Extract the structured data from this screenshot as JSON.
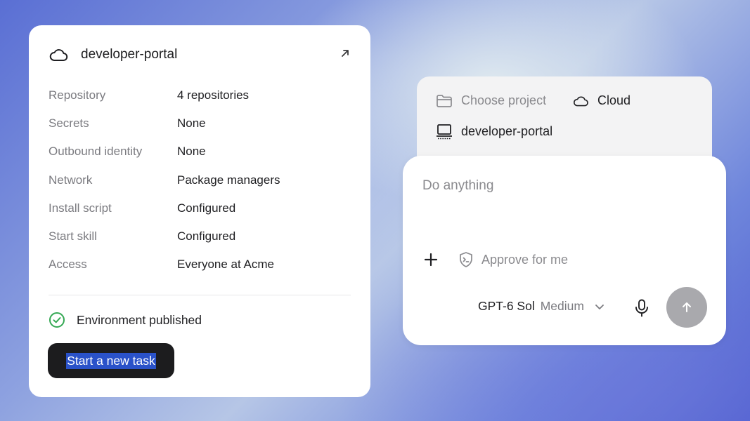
{
  "environment": {
    "title": "developer-portal",
    "properties": [
      {
        "key": "Repository",
        "value": "4 repositories"
      },
      {
        "key": "Secrets",
        "value": "None"
      },
      {
        "key": "Outbound identity",
        "value": "None"
      },
      {
        "key": "Network",
        "value": "Package managers"
      },
      {
        "key": "Install script",
        "value": "Configured"
      },
      {
        "key": "Start skill",
        "value": "Configured"
      },
      {
        "key": "Access",
        "value": "Everyone at Acme"
      }
    ],
    "status_text": "Environment published",
    "start_button_label": "Start a new task"
  },
  "project_picker": {
    "choose_label": "Choose project",
    "cloud_label": "Cloud",
    "selected_project": "developer-portal"
  },
  "prompt": {
    "placeholder": "Do anything",
    "value": "",
    "approve_label": "Approve for me",
    "model_name": "GPT-6 Sol",
    "model_level": "Medium"
  },
  "colors": {
    "success": "#34a853",
    "button_dark": "#1c1c1e",
    "send_disabled": "#a9a9ad",
    "text_highlight": "#2a52c9"
  },
  "icons": [
    "cloud-icon",
    "external-link-icon",
    "check-circle-icon",
    "folder-icon",
    "laptop-icon",
    "plus-icon",
    "shield-terminal-icon",
    "chevron-down-icon",
    "microphone-icon",
    "arrow-up-icon"
  ]
}
